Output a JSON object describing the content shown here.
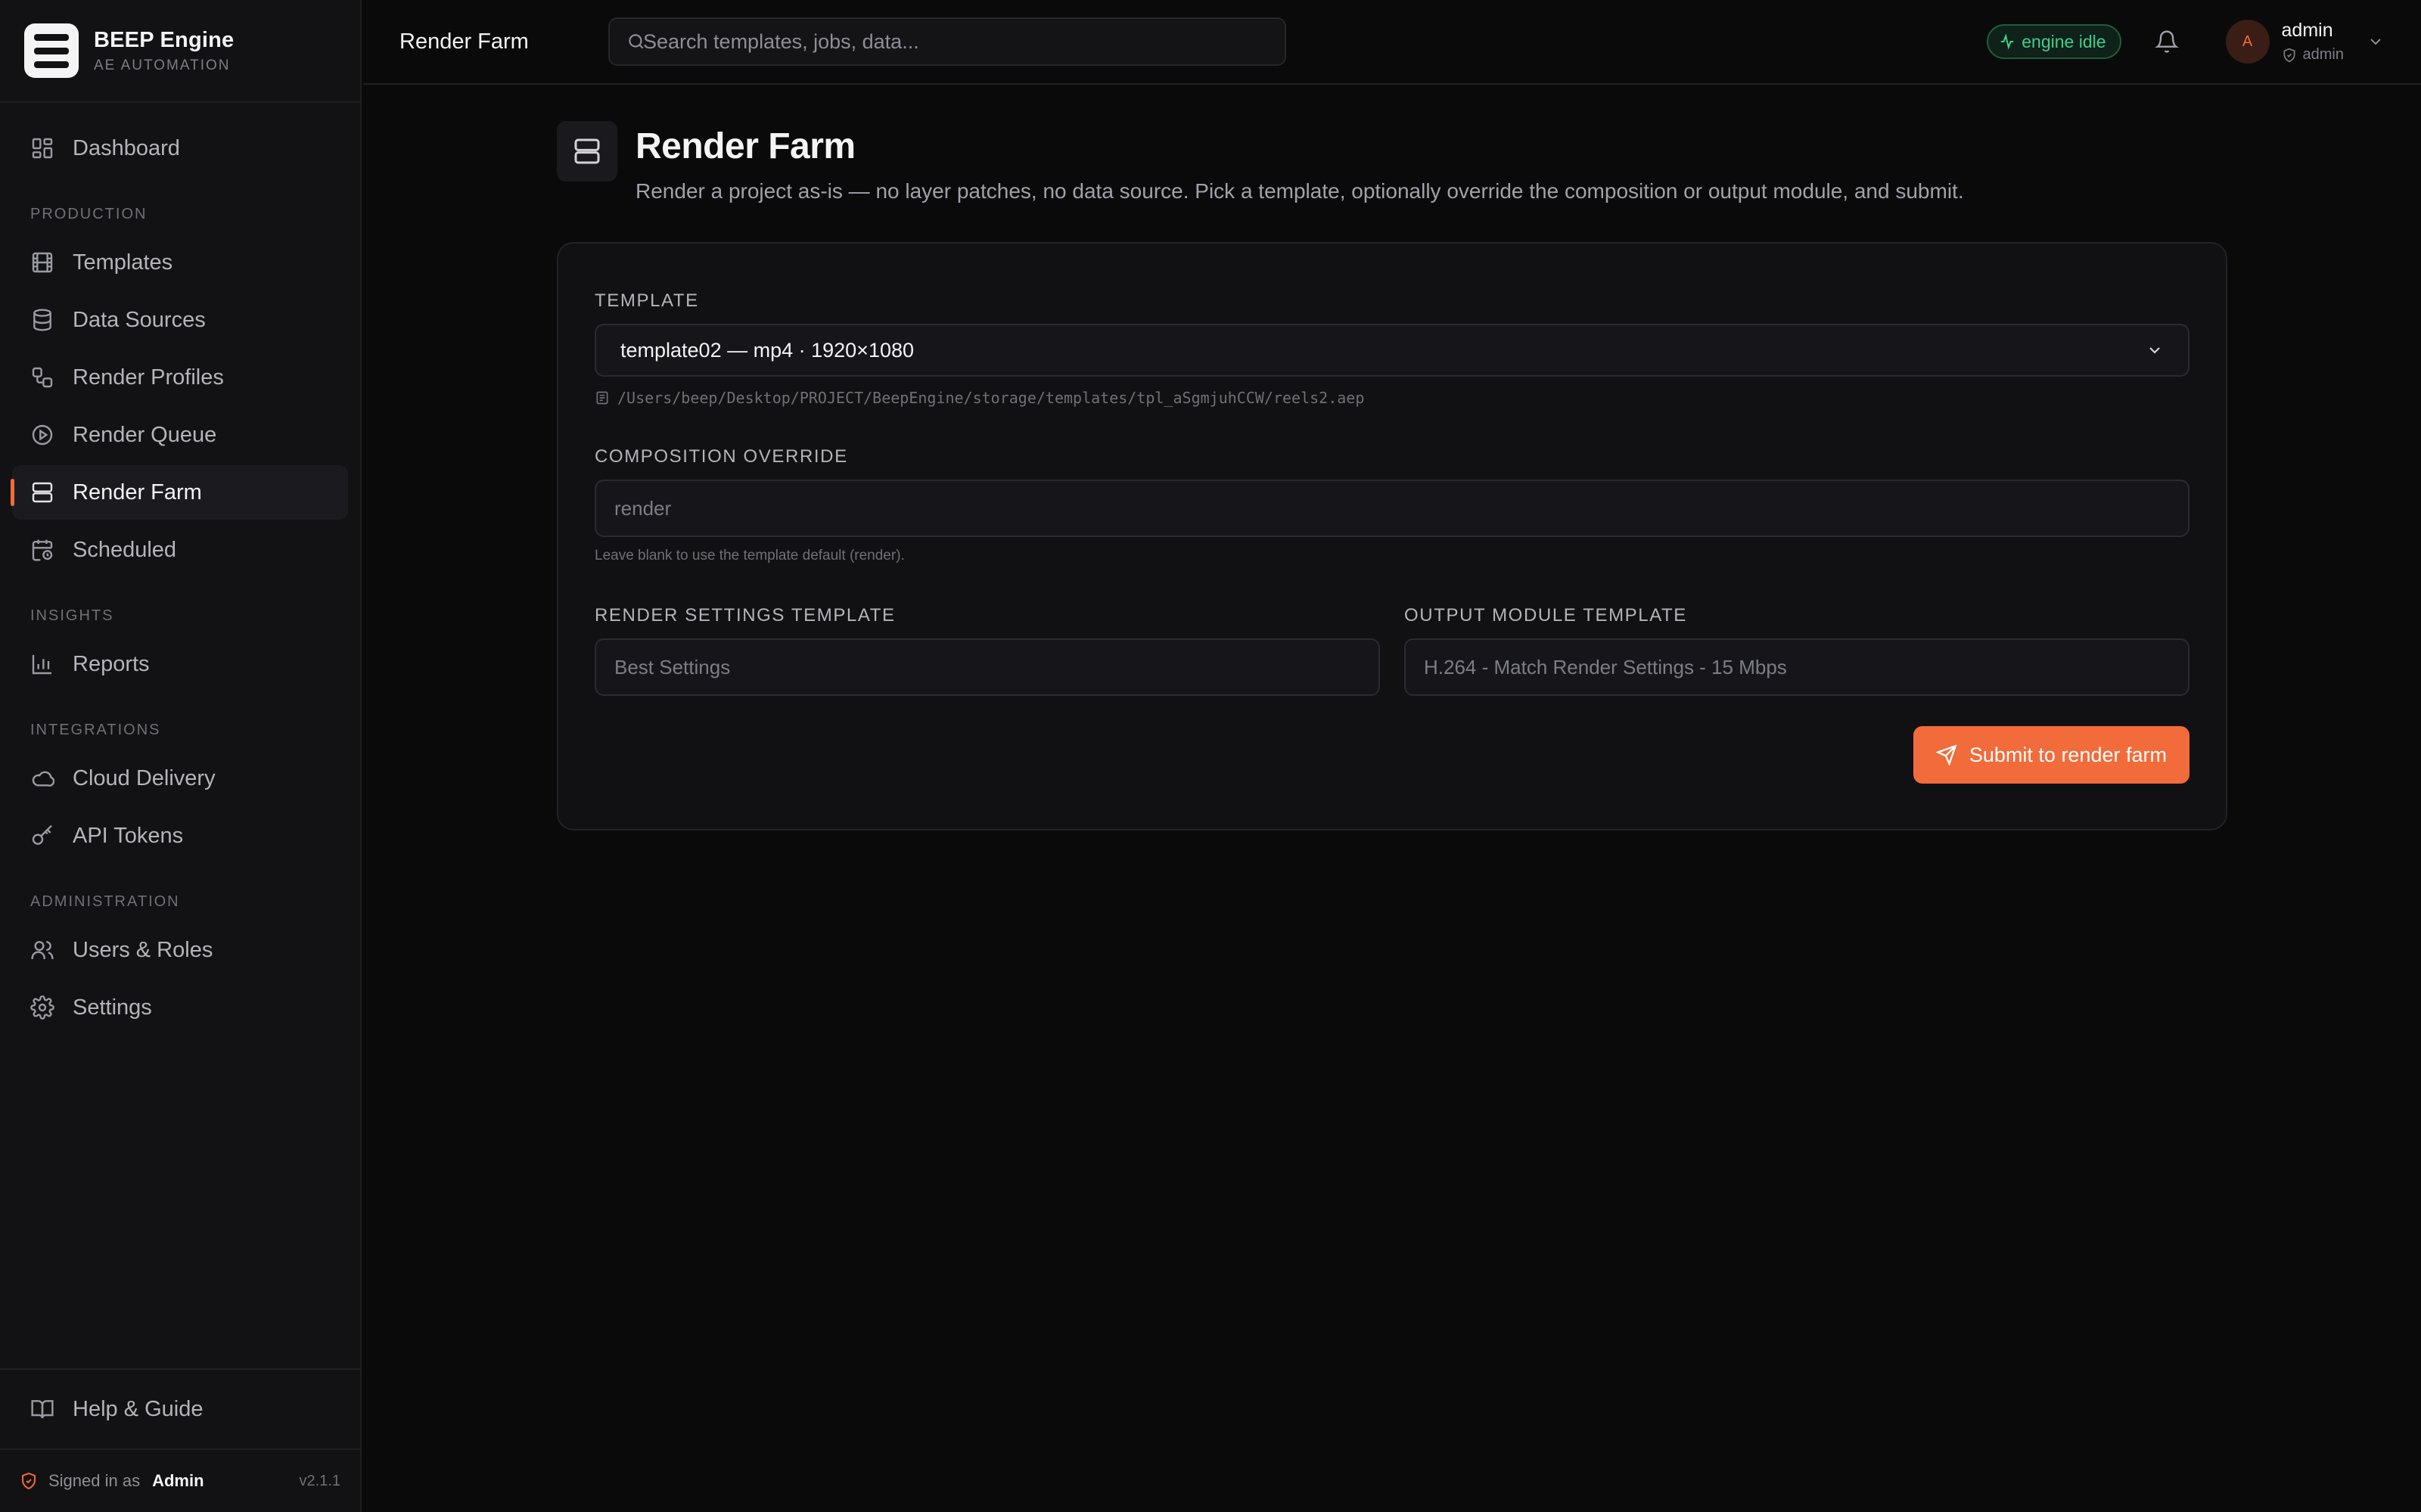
{
  "brand": {
    "name": "BEEP Engine",
    "subtitle": "AE AUTOMATION"
  },
  "sidebar": {
    "dashboard": "Dashboard",
    "sections": {
      "production": "PRODUCTION",
      "insights": "INSIGHTS",
      "integrations": "INTEGRATIONS",
      "administration": "ADMINISTRATION"
    },
    "production_items": [
      {
        "label": "Templates",
        "icon": "film-icon"
      },
      {
        "label": "Data Sources",
        "icon": "database-icon"
      },
      {
        "label": "Render Profiles",
        "icon": "workflow-icon"
      },
      {
        "label": "Render Queue",
        "icon": "play-circle-icon"
      },
      {
        "label": "Render Farm",
        "icon": "server-icon",
        "active": true
      },
      {
        "label": "Scheduled",
        "icon": "calendar-clock-icon"
      }
    ],
    "insights_items": [
      {
        "label": "Reports",
        "icon": "bar-chart-icon"
      }
    ],
    "integrations_items": [
      {
        "label": "Cloud Delivery",
        "icon": "cloud-icon"
      },
      {
        "label": "API Tokens",
        "icon": "key-icon"
      }
    ],
    "administration_items": [
      {
        "label": "Users & Roles",
        "icon": "users-icon"
      },
      {
        "label": "Settings",
        "icon": "gear-icon"
      }
    ],
    "help": "Help & Guide",
    "signed_in_prefix": "Signed in as",
    "signed_in_user": "Admin",
    "version": "v2.1.1"
  },
  "topbar": {
    "title": "Render Farm",
    "search_placeholder": "Search templates, jobs, data...",
    "engine_status": "engine idle",
    "user_name": "admin",
    "user_role": "admin",
    "avatar_initial": "A"
  },
  "page": {
    "title": "Render Farm",
    "description": "Render a project as-is — no layer patches, no data source. Pick a template, optionally override the composition or output module, and submit."
  },
  "form": {
    "template_label": "TEMPLATE",
    "template_value": "template02 — mp4 · 1920×1080",
    "template_path": "/Users/beep/Desktop/PROJECT/BeepEngine/storage/templates/tpl_aSgmjuhCCW/reels2.aep",
    "composition_label": "COMPOSITION OVERRIDE",
    "composition_placeholder": "render",
    "composition_hint": "Leave blank to use the template default (render).",
    "render_settings_label": "RENDER SETTINGS TEMPLATE",
    "render_settings_placeholder": "Best Settings",
    "output_module_label": "OUTPUT MODULE TEMPLATE",
    "output_module_placeholder": "H.264 - Match Render Settings - 15 Mbps",
    "submit_label": "Submit to render farm"
  },
  "colors": {
    "accent": "#f26b3a",
    "background": "#0a0a0b",
    "sidebar": "#121214",
    "status_green": "#3ecf8e"
  }
}
